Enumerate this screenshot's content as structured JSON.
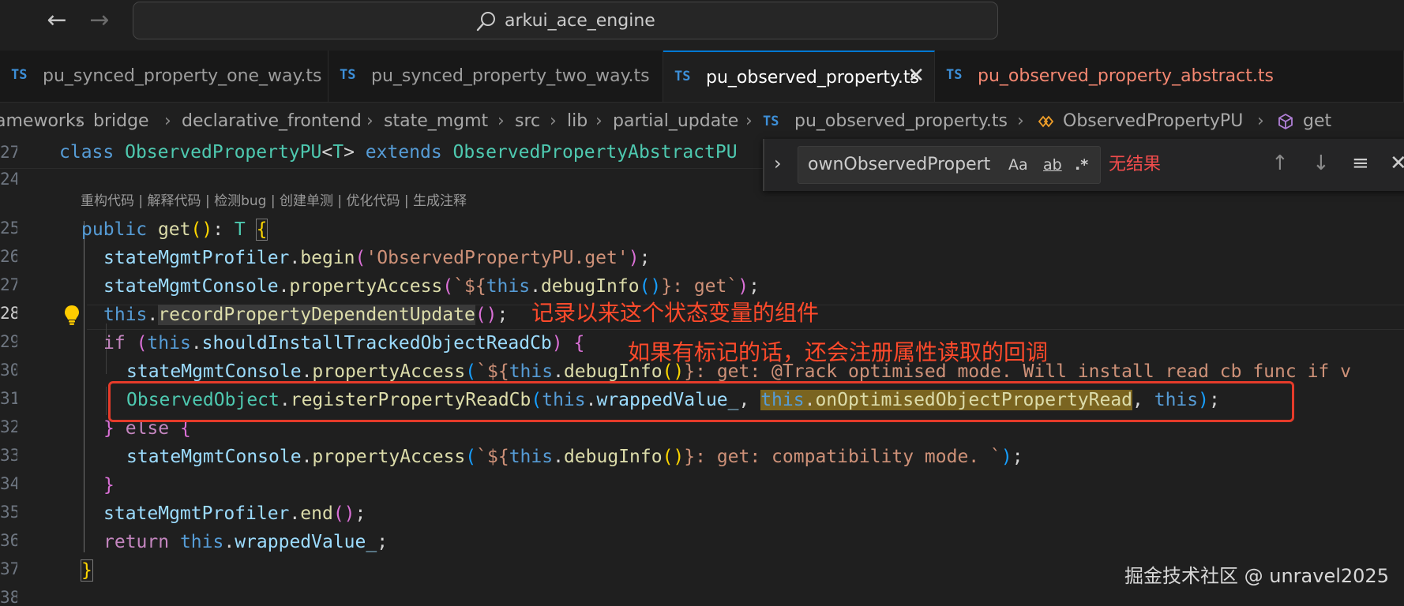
{
  "titlebar": {
    "command_center": "arkui_ace_engine",
    "back_icon": "arrow-left-icon",
    "forward_icon": "arrow-right-icon"
  },
  "tabs": [
    {
      "badge": "TS",
      "label": "pu_synced_property_one_way.ts",
      "active": false
    },
    {
      "badge": "TS",
      "label": "pu_synced_property_two_way.ts",
      "active": false
    },
    {
      "badge": "TS",
      "label": "pu_observed_property.ts",
      "active": true,
      "close": "✕"
    },
    {
      "badge": "TS",
      "label": "pu_observed_property_abstract.ts",
      "active": false,
      "modified": true
    }
  ],
  "breadcrumb": {
    "items": [
      "ameworks",
      "bridge",
      "declarative_frontend",
      "state_mgmt",
      "src",
      "lib",
      "partial_update"
    ],
    "file_badge": "TS",
    "file": "pu_observed_property.ts",
    "class": "ObservedPropertyPU",
    "method": "get"
  },
  "find": {
    "query": "ownObservedPropert",
    "match_case": "Aa",
    "whole_word": "ab",
    "regex": ".*",
    "result": "无结果",
    "toggle": "›"
  },
  "codelens": "重构代码 | 解释代码 | 检测bug | 创建单测 | 优化代码 | 生成注释",
  "line_numbers": {
    "l27a": "27",
    "l24": "24",
    "l25": "25",
    "l26": "26",
    "l27": "27",
    "l28": "28",
    "l29": "29",
    "l30": "30",
    "l31": "31",
    "l32": "32",
    "l33": "33",
    "l34": "34",
    "l35": "35",
    "l36": "36",
    "l37": "37",
    "l38": "38"
  },
  "code": {
    "sticky": {
      "kw_class": "class ",
      "name": "ObservedPropertyPU",
      "lt": "<",
      "tparam": "T",
      "gt": ">",
      "kw_extends": " extends ",
      "base": "ObservedPropertyAbstractPU"
    },
    "l25": {
      "kw": "public ",
      "fn": "get",
      "p1": "(",
      "p2": ")",
      "colon": ": ",
      "ty": "T",
      "sp": " ",
      "brace": "{"
    },
    "l26": {
      "obj": "stateMgmtProfiler",
      "dot": ".",
      "fn": "begin",
      "p1": "(",
      "str": "'ObservedPropertyPU.get'",
      "p2": ")",
      "semi": ";"
    },
    "l27": {
      "obj": "stateMgmtConsole",
      "dot": ".",
      "fn": "propertyAccess",
      "p1": "(",
      "str1": "`${",
      "this": "this",
      "dot2": ".",
      "fn2": "debugInfo",
      "p3": "()",
      "str2": "}: get`",
      "p2": ")",
      "semi": ";"
    },
    "l28": {
      "this": "this",
      "dot": ".",
      "fn": "recordPropertyDependentUpdate",
      "p1": "()",
      "semi": ";"
    },
    "l29": {
      "kw": "if",
      "sp": " ",
      "p1": "(",
      "this": "this",
      "dot": ".",
      "prop": "shouldInstallTrackedObjectReadCb",
      "p2": ")",
      "sp2": " ",
      "brace": "{"
    },
    "l30": {
      "obj": "stateMgmtConsole",
      "dot": ".",
      "fn": "propertyAccess",
      "p1": "(",
      "str1": "`${",
      "this": "this",
      "dot2": ".",
      "fn2": "debugInfo",
      "p3": "()",
      "str2": "}: get: @Track optimised mode. Will install read cb func if v"
    },
    "l31": {
      "obj": "ObservedObject",
      "dot": ".",
      "fn": "registerPropertyReadCb",
      "p1": "(",
      "this1": "this",
      "dot2": ".",
      "prop1": "wrappedValue_",
      "comma1": ", ",
      "this2": "this",
      "dot3": ".",
      "prop2": "onOptimisedObjectPropertyRead",
      "comma2": ", ",
      "this3": "this",
      "p2": ")",
      "semi": ";"
    },
    "l32": {
      "brace": "}",
      "sp": " ",
      "kw": "else",
      "sp2": " ",
      "brace2": "{"
    },
    "l33": {
      "obj": "stateMgmtConsole",
      "dot": ".",
      "fn": "propertyAccess",
      "p1": "(",
      "str1": "`${",
      "this": "this",
      "dot2": ".",
      "fn2": "debugInfo",
      "p3": "()",
      "str2": "}: get: compatibility mode. `",
      "p2": ")",
      "semi": ";"
    },
    "l34": {
      "brace": "}"
    },
    "l35": {
      "obj": "stateMgmtProfiler",
      "dot": ".",
      "fn": "end",
      "p1": "()",
      "semi": ";"
    },
    "l36": {
      "kw": "return",
      "sp": " ",
      "this": "this",
      "dot": ".",
      "prop": "wrappedValue_",
      "semi": ";"
    },
    "l37": {
      "brace": "}"
    }
  },
  "annotations": {
    "note1": "记录以来这个状态变量的组件",
    "note2": "如果有标记的话，还会注册属性读取的回调"
  },
  "watermark": "掘金技术社区 @ unravel2025",
  "colors": {
    "accent": "#0078d4",
    "annotation": "#ff4a2b",
    "no_result": "#f14c4c",
    "modified_tab": "#f48771"
  }
}
